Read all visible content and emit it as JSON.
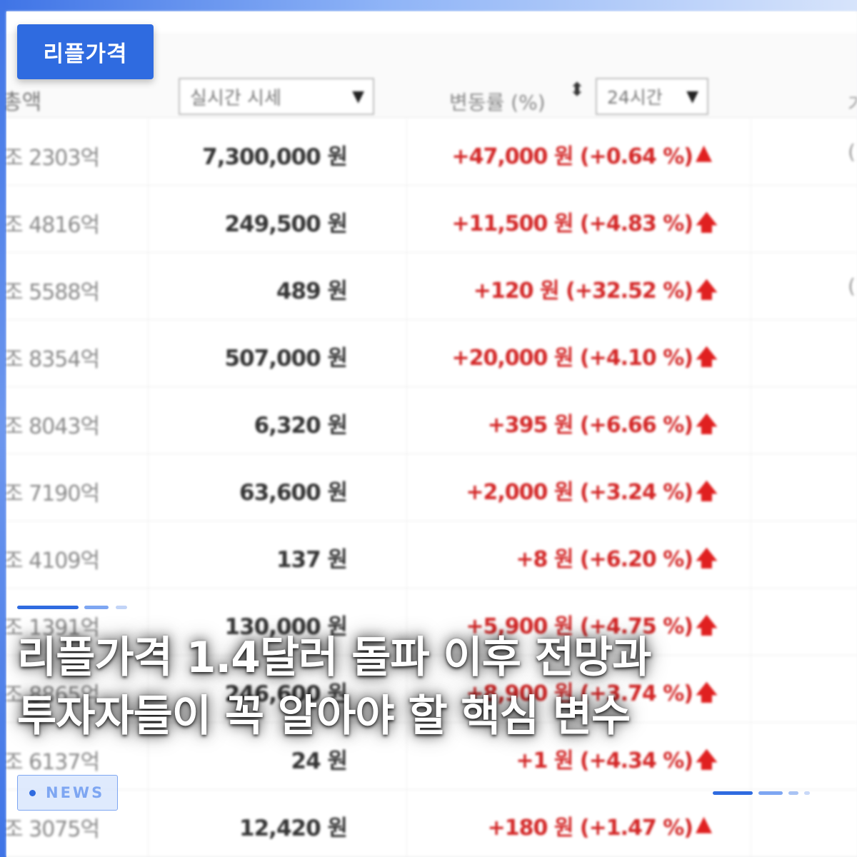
{
  "badge": {
    "label": "리플가격"
  },
  "table": {
    "header": {
      "cap_sort_fragment": "총액",
      "price_select": {
        "value": "실시간 시세",
        "caret": "▼"
      },
      "change_label": "변동률 (%)",
      "sort_glyph": "⬍",
      "period_select": {
        "value": "24시간",
        "caret": "▼"
      },
      "right_fragment": "기"
    },
    "rows": [
      {
        "cap": "조 2303억",
        "price": "7,300,000 원",
        "change": "+47,000 원 (+0.64 %)",
        "arrow": "▲",
        "side": "("
      },
      {
        "cap": "조 4816억",
        "price": "249,500 원",
        "change": "+11,500 원 (+4.83 %)",
        "arrow": "🡅",
        "side": ""
      },
      {
        "cap": "조 5588억",
        "price": "489 원",
        "change": "+120 원 (+32.52 %)",
        "arrow": "🡅",
        "side": "("
      },
      {
        "cap": "조 8354억",
        "price": "507,000 원",
        "change": "+20,000 원 (+4.10 %)",
        "arrow": "🡅",
        "side": ""
      },
      {
        "cap": "조 8043억",
        "price": "6,320 원",
        "change": "+395 원 (+6.66 %)",
        "arrow": "🡅",
        "side": ""
      },
      {
        "cap": "조 7190억",
        "price": "63,600 원",
        "change": "+2,000 원 (+3.24 %)",
        "arrow": "🡅",
        "side": ""
      },
      {
        "cap": "조 4109억",
        "price": "137 원",
        "change": "+8 원 (+6.20 %)",
        "arrow": "🡅",
        "side": ""
      },
      {
        "cap": "조 1391억",
        "price": "130,000 원",
        "change": "+5,900 원 (+4.75 %)",
        "arrow": "🡅",
        "side": ""
      },
      {
        "cap": "조 8865억",
        "price": "246,600 원",
        "change": "+8,900 원 (+3.74 %)",
        "arrow": "🡅",
        "side": ""
      },
      {
        "cap": "조 6137억",
        "price": "24 원",
        "change": "+1 원 (+4.34 %)",
        "arrow": "🡅",
        "side": ""
      },
      {
        "cap": "조 3075억",
        "price": "12,420 원",
        "change": "+180 원 (+1.47 %)",
        "arrow": "▲",
        "side": ""
      }
    ]
  },
  "headline": {
    "line1": "리플가격 1.4달러 돌파 이후 전망과",
    "line2": "투자자들이 꼭 알아야 할 핵심 변수"
  },
  "news_tag": {
    "label": "NEWS"
  },
  "colors": {
    "accent": "#2f6be0",
    "price_up": "#d32626",
    "news_border": "#7ea6f2"
  }
}
